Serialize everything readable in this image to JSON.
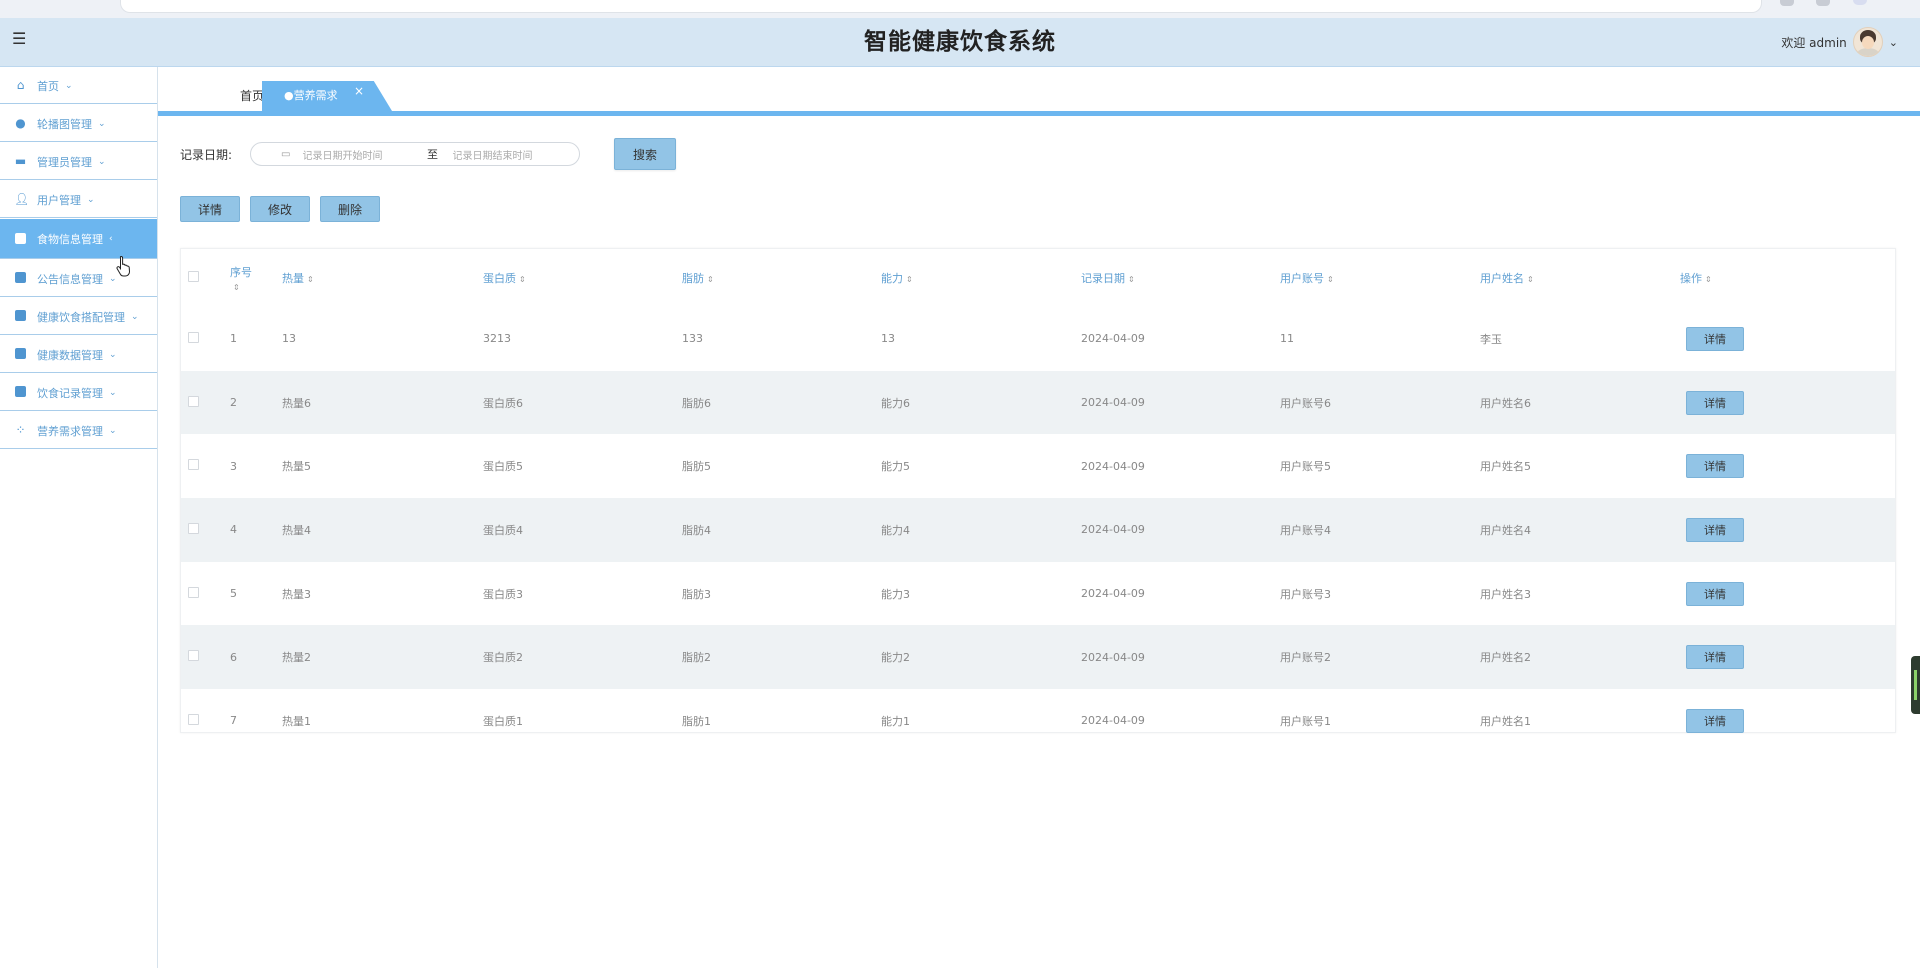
{
  "header": {
    "title": "智能健康饮食系统",
    "welcome": "欢迎 admin",
    "menu_icon": "hamburger-icon",
    "avatar_icon": "user-avatar-icon"
  },
  "sidebar": {
    "items": [
      {
        "label": "首页",
        "icon": "home-icon"
      },
      {
        "label": "轮播图管理",
        "icon": "drop-icon"
      },
      {
        "label": "管理员管理",
        "icon": "monitor-icon"
      },
      {
        "label": "用户管理",
        "icon": "user-icon"
      },
      {
        "label": "食物信息管理",
        "icon": "image-icon",
        "active": true
      },
      {
        "label": "公告信息管理",
        "icon": "grid-icon"
      },
      {
        "label": "健康饮食搭配管理",
        "icon": "table-icon"
      },
      {
        "label": "健康数据管理",
        "icon": "dashboard-icon"
      },
      {
        "label": "饮食记录管理",
        "icon": "record-icon"
      },
      {
        "label": "营养需求管理",
        "icon": "apps-icon"
      }
    ]
  },
  "tabs": {
    "home": "首页",
    "active": "●营养需求",
    "close": "×"
  },
  "search": {
    "label": "记录日期:",
    "start_placeholder": "记录日期开始时间",
    "separator": "至",
    "end_placeholder": "记录日期结束时间",
    "button": "搜索"
  },
  "actions": {
    "detail": "详情",
    "edit": "修改",
    "delete": "删除"
  },
  "table": {
    "columns": [
      "序号",
      "热量",
      "蛋白质",
      "脂肪",
      "能力",
      "记录日期",
      "用户账号",
      "用户姓名",
      "操作"
    ],
    "detail_label": "详情",
    "rows": [
      {
        "no": "1",
        "calorie": "13",
        "protein": "3213",
        "fat": "133",
        "ability": "13",
        "date": "2024-04-09",
        "account": "11",
        "name": "李玉"
      },
      {
        "no": "2",
        "calorie": "热量6",
        "protein": "蛋白质6",
        "fat": "脂肪6",
        "ability": "能力6",
        "date": "2024-04-09",
        "account": "用户账号6",
        "name": "用户姓名6"
      },
      {
        "no": "3",
        "calorie": "热量5",
        "protein": "蛋白质5",
        "fat": "脂肪5",
        "ability": "能力5",
        "date": "2024-04-09",
        "account": "用户账号5",
        "name": "用户姓名5"
      },
      {
        "no": "4",
        "calorie": "热量4",
        "protein": "蛋白质4",
        "fat": "脂肪4",
        "ability": "能力4",
        "date": "2024-04-09",
        "account": "用户账号4",
        "name": "用户姓名4"
      },
      {
        "no": "5",
        "calorie": "热量3",
        "protein": "蛋白质3",
        "fat": "脂肪3",
        "ability": "能力3",
        "date": "2024-04-09",
        "account": "用户账号3",
        "name": "用户姓名3"
      },
      {
        "no": "6",
        "calorie": "热量2",
        "protein": "蛋白质2",
        "fat": "脂肪2",
        "ability": "能力2",
        "date": "2024-04-09",
        "account": "用户账号2",
        "name": "用户姓名2"
      },
      {
        "no": "7",
        "calorie": "热量1",
        "protein": "蛋白质1",
        "fat": "脂肪1",
        "ability": "能力1",
        "date": "2024-04-09",
        "account": "用户账号1",
        "name": "用户姓名1"
      }
    ]
  },
  "colors": {
    "accent": "#6cb6ef",
    "button": "#92c4e6",
    "header_bg": "#d6e6f3",
    "link": "#5f9fd2"
  }
}
